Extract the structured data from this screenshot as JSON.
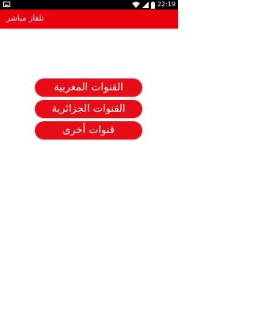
{
  "status_bar": {
    "time": "22:19",
    "icons": [
      "image-icon",
      "wifi-icon",
      "signal-icon",
      "battery-icon"
    ]
  },
  "app_bar": {
    "title": "تلفاز مباشر",
    "color": "#e8000c"
  },
  "menu": {
    "button_color": "#e60d17",
    "items": [
      {
        "label": "القنوات المغربية"
      },
      {
        "label": "القنوات الجزائرية"
      },
      {
        "label": "قنوات أخرى"
      }
    ]
  }
}
